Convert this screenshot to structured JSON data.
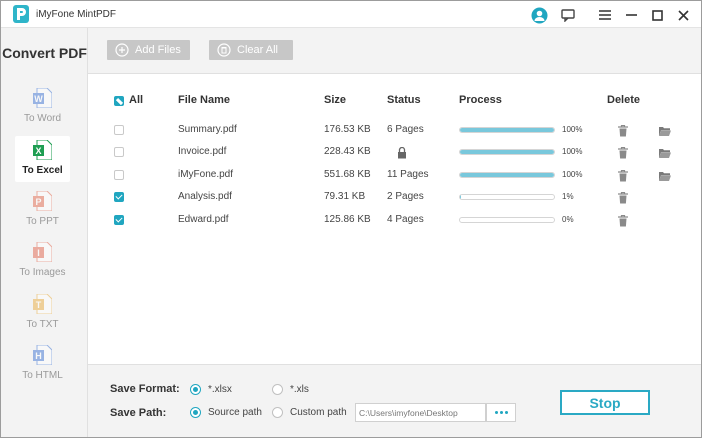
{
  "app": {
    "title": "iMyFone MintPDF"
  },
  "sidebar": {
    "title": "Convert PDF",
    "items": [
      {
        "label": "To Word",
        "icon": "word-icon",
        "color": "#2b67d1",
        "active": false
      },
      {
        "label": "To Excel",
        "icon": "excel-icon",
        "color": "#1e9e52",
        "active": true
      },
      {
        "label": "To PPT",
        "icon": "ppt-icon",
        "color": "#e05a3a",
        "active": false
      },
      {
        "label": "To Images",
        "icon": "image-icon",
        "color": "#e0553a",
        "active": false
      },
      {
        "label": "To TXT",
        "icon": "txt-icon",
        "color": "#e8a52b",
        "active": false
      },
      {
        "label": "To HTML",
        "icon": "html-icon",
        "color": "#2b67d1",
        "active": false
      }
    ]
  },
  "toolbar": {
    "add_label": "Add Files",
    "clear_label": "Clear All"
  },
  "table": {
    "headers": {
      "all": "All",
      "file_name": "File Name",
      "size": "Size",
      "status": "Status",
      "process": "Process",
      "delete": "Delete"
    },
    "rows": [
      {
        "checked": false,
        "name": "Summary.pdf",
        "size": "176.53 KB",
        "status": "6 Pages",
        "locked": false,
        "progress": 1.0,
        "percent": "100%",
        "folder": true
      },
      {
        "checked": false,
        "name": "Invoice.pdf",
        "size": "228.43 KB",
        "status": "",
        "locked": true,
        "progress": 1.0,
        "percent": "100%",
        "folder": true
      },
      {
        "checked": false,
        "name": "iMyFone.pdf",
        "size": "551.68 KB",
        "status": "11 Pages",
        "locked": false,
        "progress": 1.0,
        "percent": "100%",
        "folder": true
      },
      {
        "checked": true,
        "name": "Analysis.pdf",
        "size": "79.31 KB",
        "status": "2 Pages",
        "locked": false,
        "progress": 0.01,
        "percent": "1%",
        "folder": false
      },
      {
        "checked": true,
        "name": "Edward.pdf",
        "size": "125.86 KB",
        "status": "4 Pages",
        "locked": false,
        "progress": 0.0,
        "percent": "0%",
        "folder": false
      }
    ]
  },
  "footer": {
    "save_format_label": "Save Format:",
    "save_path_label": "Save Path:",
    "format_options": [
      {
        "label": "*.xlsx",
        "selected": true
      },
      {
        "label": "*.xls",
        "selected": false
      }
    ],
    "path_options": [
      {
        "label": "Source path",
        "selected": true
      },
      {
        "label": "Custom path",
        "selected": false
      }
    ],
    "path_value": "C:\\Users\\imyfone\\Desktop",
    "stop_label": "Stop"
  },
  "colors": {
    "accent": "#20a6c0",
    "progress": "#79c8dc"
  }
}
